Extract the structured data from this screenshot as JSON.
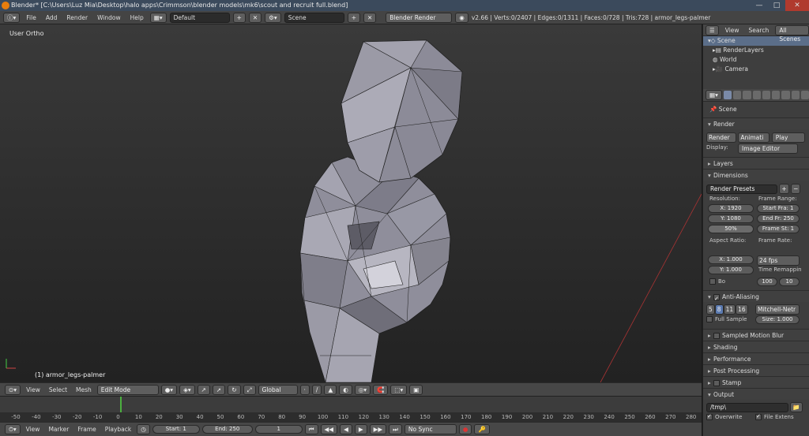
{
  "window": {
    "title": "Blender* [C:\\Users\\Luz Mia\\Desktop\\halo apps\\Crimmson\\blender models\\mk6\\scout and recruit full.blend]",
    "minimize": "—",
    "maximize": "□",
    "close": "✕"
  },
  "info_header": {
    "menus": [
      "File",
      "Add",
      "Render",
      "Window",
      "Help"
    ],
    "layout": "Default",
    "scene": "Scene",
    "engine": "Blender Render",
    "stats": "v2.66 | Verts:0/2407 | Edges:0/1311 | Faces:0/728 | Tris:728 | armor_legs-palmer"
  },
  "viewport": {
    "view_label": "User Ortho",
    "object_label": "(1) armor_legs-palmer"
  },
  "viewport_header": {
    "menus": [
      "View",
      "Select",
      "Mesh"
    ],
    "mode": "Edit Mode",
    "orientation": "Global"
  },
  "timeline": {
    "ticks": [
      "-50",
      "-40",
      "-30",
      "-20",
      "-10",
      "0",
      "10",
      "20",
      "30",
      "40",
      "50",
      "60",
      "70",
      "80",
      "90",
      "100",
      "110",
      "120",
      "130",
      "140",
      "150",
      "160",
      "170",
      "180",
      "190",
      "200",
      "210",
      "220",
      "230",
      "240",
      "250",
      "260",
      "270",
      "280"
    ],
    "current_frame_marker": 0
  },
  "timeline_header": {
    "menus": [
      "View",
      "Marker",
      "Frame",
      "Playback"
    ],
    "start": "Start: 1",
    "end": "End: 250",
    "current": "1",
    "sync": "No Sync"
  },
  "outliner": {
    "header": {
      "view": "View",
      "search": "Search",
      "filter": "All Scenes"
    },
    "items": [
      "Scene",
      "RenderLayers",
      "World",
      "Camera"
    ]
  },
  "properties": {
    "breadcrumb": "Scene",
    "render_panel": "Render",
    "render_btn": "Render",
    "anim_btn": "Animati",
    "play_btn": "Play",
    "display_label": "Display:",
    "display_value": "Image Editor",
    "layers": "Layers",
    "dimensions": "Dimensions",
    "render_presets": "Render Presets",
    "resolution_label": "Resolution:",
    "res_x": "X: 1920",
    "res_y": "Y: 1080",
    "res_pct": "50%",
    "frame_range_label": "Frame Range:",
    "start_frame": "Start Fra: 1",
    "end_frame": "End Fr: 250",
    "frame_step": "Frame St: 1",
    "aspect_label": "Aspect Ratio:",
    "aspect_x": "X: 1.000",
    "aspect_y": "Y: 1.000",
    "frame_rate_label": "Frame Rate:",
    "frame_rate": "24 fps",
    "remap_label": "Time Remappin",
    "remap_old": "100",
    "remap_new": "10",
    "border_label": "Bo",
    "anti_aliasing": "Anti-Aliasing",
    "aa_samples": [
      "5",
      "8",
      "11",
      "16"
    ],
    "aa_selected": "8",
    "aa_filter": "Mitchell-Netr",
    "full_sample": "Full Sample",
    "aa_size": "Size: 1.000",
    "sampled_motion_blur": "Sampled Motion Blur",
    "shading": "Shading",
    "performance": "Performance",
    "post_processing": "Post Processing",
    "stamp": "Stamp",
    "output": "Output",
    "output_path": "/tmp\\",
    "overwrite": "Overwrite",
    "file_extensions": "File Extens"
  },
  "colors": {
    "accent_blue": "#5b6e89",
    "mesh_face": "#9b9aa6",
    "mesh_edge": "#1f1f1f",
    "title_bg": "#3b4a5c",
    "frame_marker": "#4caf3f"
  }
}
